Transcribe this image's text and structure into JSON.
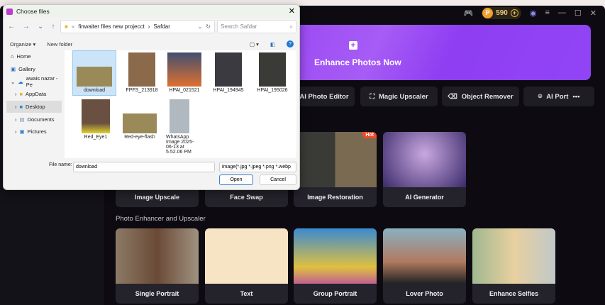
{
  "app": {
    "coins": "590",
    "banner_label": "Enhance Photos Now",
    "tools": [
      "AI Photo Editor",
      "Magic Upscaler",
      "Object Remover",
      "AI Port"
    ],
    "row1": [
      {
        "label": "Image Upscale"
      },
      {
        "label": "Face Swap"
      },
      {
        "label": "Image Restoration",
        "badge": "Hot"
      },
      {
        "label": "AI Generator"
      }
    ],
    "section_title": "Photo Enhancer and Upscaler",
    "row2": [
      {
        "label": "Single Portrait"
      },
      {
        "label": "Text"
      },
      {
        "label": "Group Portrait"
      },
      {
        "label": "Lover Photo"
      },
      {
        "label": "Enhance Selfies"
      }
    ],
    "accent": "#8a2af0"
  },
  "dialog": {
    "title": "Choose files",
    "close": "✕",
    "path": [
      "finwaiter files new projecct",
      "Safdar"
    ],
    "search_placeholder": "Search Safdar",
    "organize": "Organize ▾",
    "new_folder": "New folder",
    "tree": [
      "Home",
      "Gallery",
      "awais nazar - Pe",
      "AppData",
      "Desktop",
      "Documents",
      "Pictures"
    ],
    "files": [
      "download",
      "FPFS_213918",
      "HPAI_021521",
      "HPAI_194945",
      "HPAI_195026",
      "Red_Eye1",
      "Red-eye-flash",
      "WhatsApp Image 2025-06-13 at 5.52.06 PM"
    ],
    "file_name_label": "File name:",
    "file_name_value": "download",
    "filter": "image(*.jpg *.jpeg *.png *.webp",
    "open": "Open",
    "cancel": "Cancel"
  }
}
